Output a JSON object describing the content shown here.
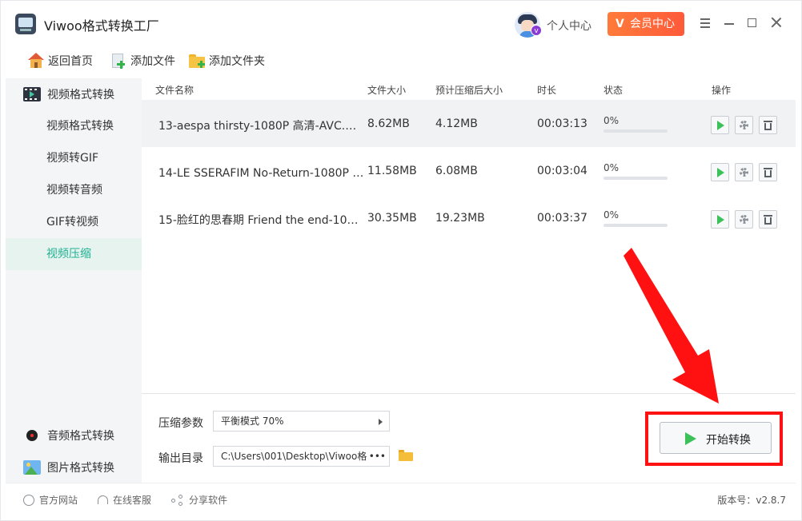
{
  "app": {
    "title": "Viwoo格式转换工厂",
    "user_center": "个人中心",
    "member_label": "会员中心",
    "member_badge": "V",
    "vip_mark": "v"
  },
  "toolbar": {
    "home_label": "返回首页",
    "add_file_label": "添加文件",
    "add_folder_label": "添加文件夹"
  },
  "sidebar": {
    "video_group": "视频格式转换",
    "items": [
      {
        "label": "视频格式转换",
        "active": false
      },
      {
        "label": "视频转GIF",
        "active": false
      },
      {
        "label": "视频转音频",
        "active": false
      },
      {
        "label": "GIF转视频",
        "active": false
      },
      {
        "label": "视频压缩",
        "active": true
      }
    ],
    "audio_group": "音频格式转换",
    "image_group": "图片格式转换"
  },
  "table": {
    "headers": {
      "name": "文件名称",
      "size": "文件大小",
      "compressed": "预计压缩后大小",
      "duration": "时长",
      "status": "状态",
      "actions": "操作"
    },
    "rows": [
      {
        "name": "13-aespa thirsty-1080P 高清-AVC.mp4",
        "size": "8.62MB",
        "compressed": "4.12MB",
        "duration": "00:03:13",
        "progress_text": "0%",
        "progress": 0
      },
      {
        "name": "14-LE SSERAFIM No-Return-1080P 高...",
        "size": "11.58MB",
        "compressed": "6.08MB",
        "duration": "00:03:04",
        "progress_text": "0%",
        "progress": 0
      },
      {
        "name": "15-脸红的思春期 Friend the end-1080...",
        "size": "30.35MB",
        "compressed": "19.23MB",
        "duration": "00:03:37",
        "progress_text": "0%",
        "progress": 0
      }
    ]
  },
  "settings": {
    "param_label": "压缩参数",
    "param_value": "平衡模式 70%",
    "output_label": "输出目录",
    "output_path": "C:\\Users\\001\\Desktop\\Viwoo格式",
    "output_more": "•••",
    "start_label": "开始转换"
  },
  "footer": {
    "website": "官方网站",
    "support": "在线客服",
    "share": "分享软件",
    "version": "版本号：v2.8.7"
  },
  "colors": {
    "accent": "#1fb193",
    "member": "#ff6a3a",
    "highlight": "#ff1111",
    "play": "#3cc05a"
  }
}
